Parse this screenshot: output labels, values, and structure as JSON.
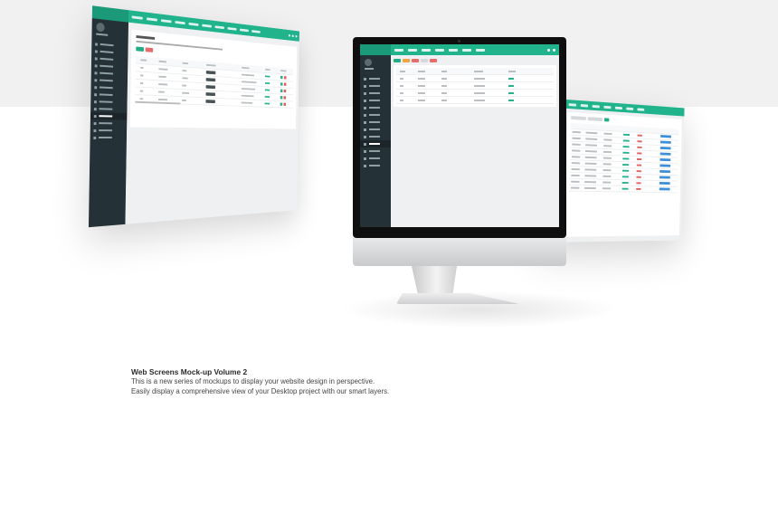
{
  "description": {
    "title": "Web Screens Mock-up Volume 2",
    "line1": "This is a new series of mockups to display your website design in perspective.",
    "line2": "Easily display a comprehensive view of your Desktop project with our smart layers."
  },
  "colors": {
    "accent": "#20b38c",
    "sidebar": "#243136",
    "background_top": "#f1f1f1",
    "background": "#ffffff",
    "danger": "#e76b6b"
  },
  "mockups": {
    "left_screen": "floating-browser-screen",
    "center_device": "imac-device",
    "right_screen": "floating-browser-screen"
  }
}
